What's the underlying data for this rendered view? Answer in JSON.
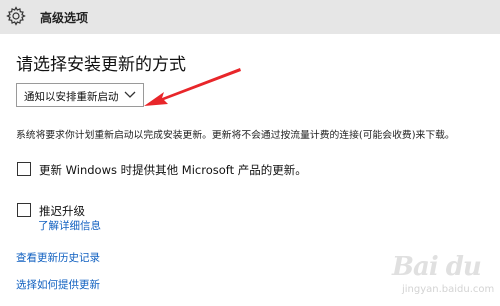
{
  "header": {
    "title": "高级选项",
    "icon": "gear-icon"
  },
  "main": {
    "heading": "请选择安装更新的方式",
    "install_mode": {
      "selected": "通知以安排重新启动",
      "icon": "chevron-down-icon"
    },
    "description": "系统将要求你计划重新启动以完成安装更新。更新将不会通过按流量计费的连接(可能会收费)来下载。",
    "options": [
      {
        "label": "更新 Windows 时提供其他 Microsoft 产品的更新。",
        "checked": false
      },
      {
        "label": "推迟升级",
        "checked": false
      }
    ],
    "learn_more": "了解详细信息",
    "links": {
      "history": "查看更新历史记录",
      "delivery": "选择如何提供更新"
    }
  },
  "annotation": {
    "arrow_color": "#e8262a"
  },
  "watermark": {
    "logo_text": "Bai du",
    "sub_text": "jingyan.baidu.com"
  }
}
